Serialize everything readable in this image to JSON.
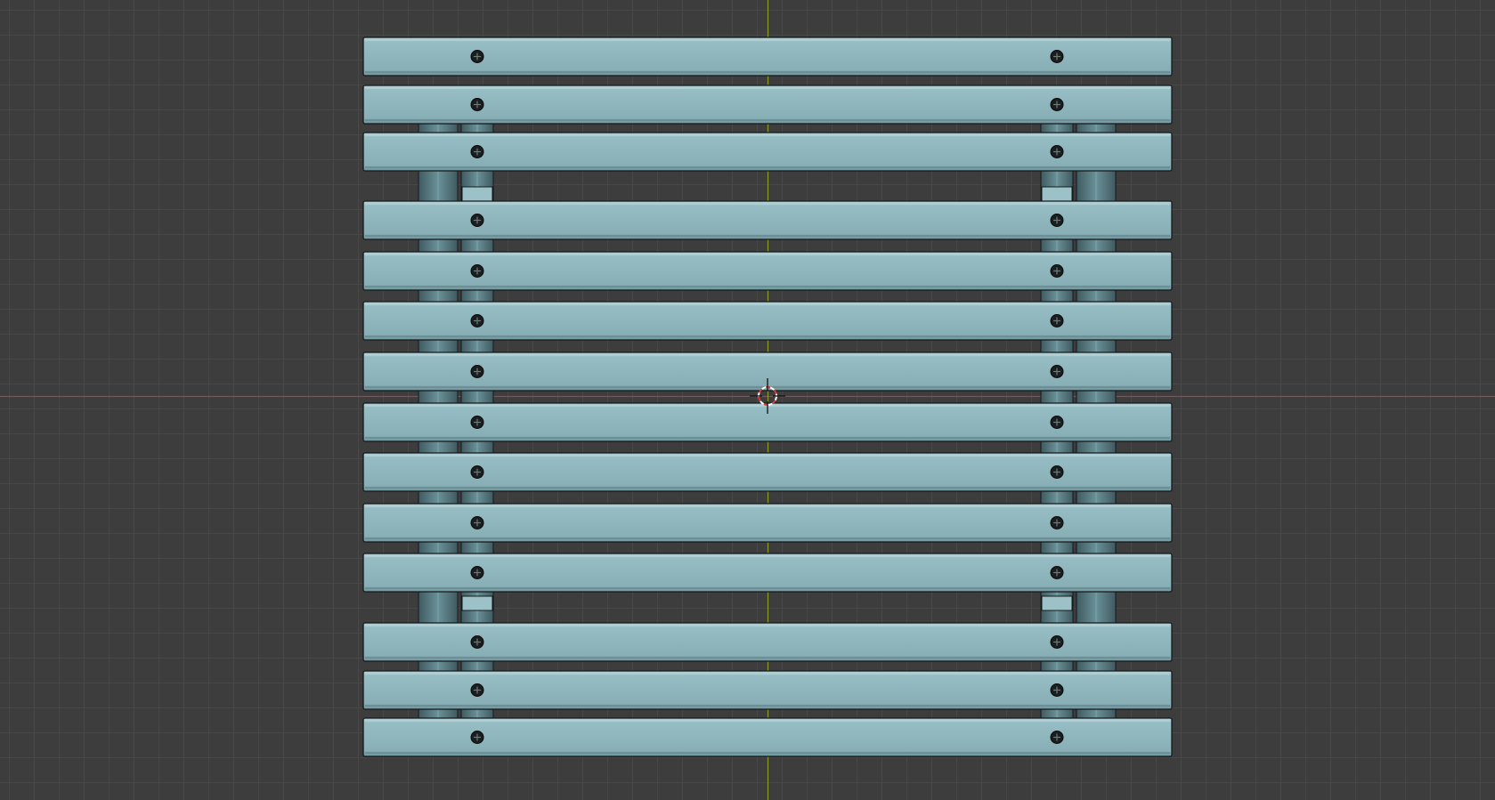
{
  "viewport": {
    "view": "top-orthographic",
    "shading": "solid",
    "grid": true
  },
  "colors": {
    "background": "#3d3d3d",
    "grid_line": "#484848",
    "x_axis": "#a8414f",
    "y_axis": "#8a9a2b",
    "slat_fill": "#8fb6bd",
    "slat_top": "#a6c8ce",
    "slat_outline": "#15191a",
    "support_fill": "#5f858c",
    "support_dark": "#3c5459",
    "screw": "#1b1e1f"
  },
  "model": {
    "object": "bench-seat",
    "slat_count": 14,
    "screws_per_slat": 2,
    "support_legs": 4
  },
  "icons": {
    "cursor": "3d-cursor-icon"
  }
}
